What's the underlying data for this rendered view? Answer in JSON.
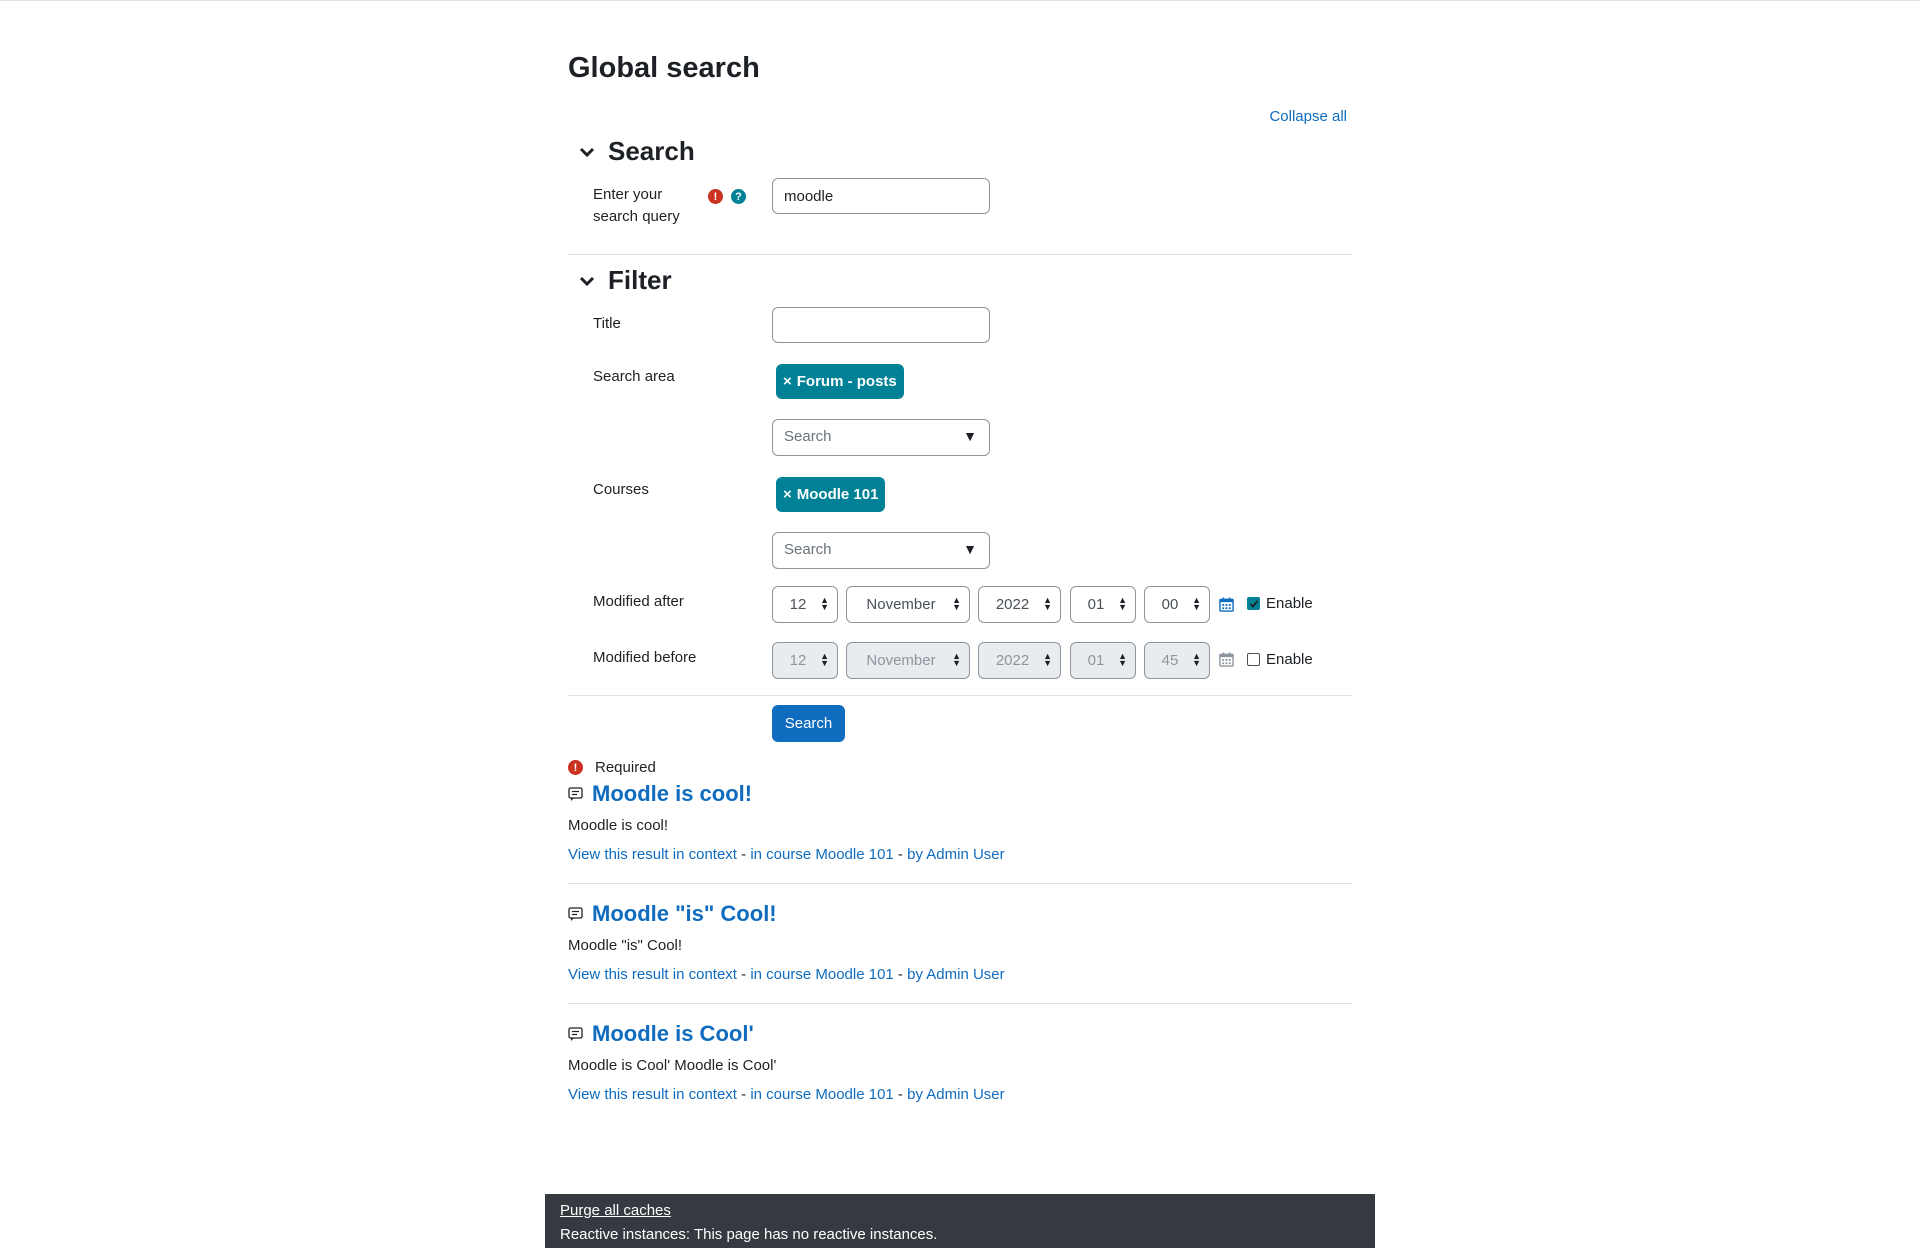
{
  "page": {
    "title": "Global search",
    "collapse_all": "Collapse all"
  },
  "search_section": {
    "heading": "Search",
    "query_label": "Enter your search query",
    "query_value": "moodle"
  },
  "filter_section": {
    "heading": "Filter",
    "title_label": "Title",
    "title_value": "",
    "area_label": "Search area",
    "area_tag": "Forum - posts",
    "area_placeholder": "Search",
    "courses_label": "Courses",
    "courses_tag": "Moodle 101",
    "courses_placeholder": "Search",
    "modified_after": {
      "label": "Modified after",
      "day": "12",
      "month": "November",
      "year": "2022",
      "hour": "01",
      "minute": "00",
      "enable_label": "Enable",
      "enabled": true
    },
    "modified_before": {
      "label": "Modified before",
      "day": "12",
      "month": "November",
      "year": "2022",
      "hour": "01",
      "minute": "45",
      "enable_label": "Enable",
      "enabled": false
    },
    "search_button": "Search",
    "required_label": "Required"
  },
  "results": [
    {
      "title": "Moodle is cool!",
      "content": "Moodle is cool!",
      "context_link": "View this result in context",
      "course_link": "in course Moodle 101",
      "author_link": "by Admin User"
    },
    {
      "title": "Moodle \"is\" Cool!",
      "content": "Moodle \"is\" Cool!",
      "context_link": "View this result in context",
      "course_link": "in course Moodle 101",
      "author_link": "by Admin User"
    },
    {
      "title": "Moodle is Cool'",
      "content": "Moodle is Cool' Moodle is Cool'",
      "context_link": "View this result in context",
      "course_link": "in course Moodle 101",
      "author_link": "by Admin User"
    }
  ],
  "footer": {
    "purge": "Purge all caches",
    "reactive": "Reactive instances: This page has no reactive instances."
  },
  "icons": {
    "chevron": "chevron-down-icon",
    "required": "exclamation-circle-icon",
    "help": "question-circle-icon",
    "calendar": "calendar-icon",
    "forum_post": "forum-post-icon",
    "tag_remove": "×"
  },
  "colors": {
    "link": "#0f6cbf",
    "tag_bg": "#008196",
    "required": "#ca3120",
    "footer_bg": "#343a40"
  }
}
